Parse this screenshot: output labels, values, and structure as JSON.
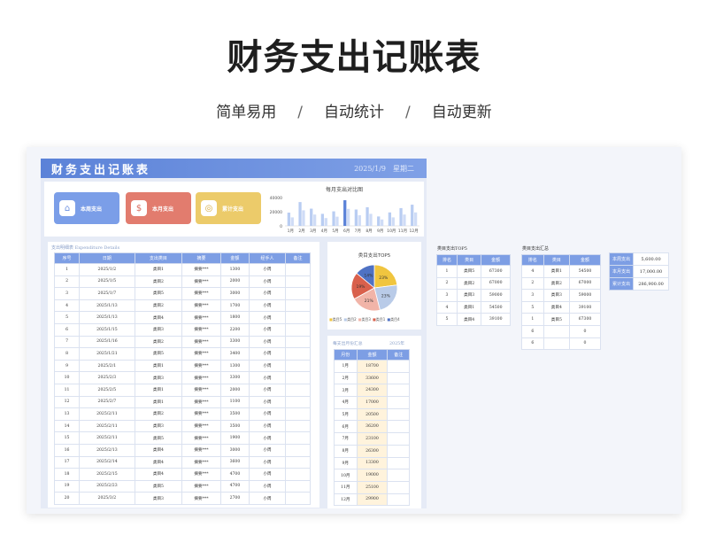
{
  "hero": {
    "title": "财务支出记账表",
    "tags": [
      "简单易用",
      "自动统计",
      "自动更新"
    ],
    "separator": "/"
  },
  "sheet": {
    "title": "财务支出记账表",
    "date": "2025/1/9",
    "weekday": "星期二"
  },
  "cards": [
    {
      "label": "本周支出",
      "color": "#7b9ee8",
      "icon": "calendar-icon",
      "glyph": "⌂"
    },
    {
      "label": "本月支出",
      "color": "#e27c6e",
      "icon": "money-bag-icon",
      "glyph": "$"
    },
    {
      "label": "累计支出",
      "color": "#eccb6a",
      "icon": "coin-icon",
      "glyph": "◎"
    }
  ],
  "chart_data": [
    {
      "type": "bar",
      "title": "每月支出对比图",
      "categories": [
        "1月",
        "2月",
        "3月",
        "4月",
        "5月",
        "6月",
        "7月",
        "8月",
        "9月",
        "10月",
        "11月",
        "12月"
      ],
      "ylim": [
        0,
        40000
      ],
      "yticks": [
        "40000",
        "20000",
        "0"
      ],
      "series": [
        {
          "values": [
            18700,
            33600,
            24300,
            17000,
            20500,
            36200,
            23100,
            26300,
            13300,
            19000,
            25100,
            29900
          ],
          "color": "#b9cdf2"
        },
        {
          "values": [
            12000,
            22000,
            16000,
            11000,
            13000,
            24000,
            15000,
            17000,
            9000,
            12000,
            16000,
            19000
          ],
          "color": "#cfdcf6"
        }
      ],
      "highlight_index": 5,
      "highlight_color": "#5b82d8"
    },
    {
      "type": "pie",
      "title": "类目支出TOP5",
      "categories": [
        "类目5",
        "类目2",
        "类目3",
        "类目1",
        "类目4"
      ],
      "values": [
        23,
        23,
        21,
        19,
        14
      ],
      "labels": [
        "23%",
        "23%",
        "21%",
        "19%",
        "14%"
      ],
      "colors": [
        "#f0c53f",
        "#b9cbe8",
        "#f1b4a8",
        "#d9604c",
        "#4f72c4"
      ]
    }
  ],
  "detail": {
    "caption": "支出明细表    Expenditure Details",
    "headers": [
      "序号",
      "日期",
      "支出类目",
      "摘要",
      "金额",
      "经手人",
      "备注"
    ],
    "rows": [
      [
        "1",
        "2025/1/2",
        "类目1",
        "摘要***",
        "1300",
        "小周",
        ""
      ],
      [
        "2",
        "2025/1/5",
        "类目2",
        "摘要***",
        "2000",
        "小周",
        ""
      ],
      [
        "3",
        "2025/1/7",
        "类目5",
        "摘要***",
        "3000",
        "小周",
        ""
      ],
      [
        "4",
        "2025/1/13",
        "类目2",
        "摘要***",
        "1700",
        "小周",
        ""
      ],
      [
        "5",
        "2025/1/13",
        "类目4",
        "摘要***",
        "1800",
        "小周",
        ""
      ],
      [
        "6",
        "2025/1/15",
        "类目3",
        "摘要***",
        "2200",
        "小周",
        ""
      ],
      [
        "7",
        "2025/1/16",
        "类目2",
        "摘要***",
        "3300",
        "小周",
        ""
      ],
      [
        "8",
        "2025/1/21",
        "类目5",
        "摘要***",
        "3400",
        "小周",
        ""
      ],
      [
        "9",
        "2025/2/1",
        "类目1",
        "摘要***",
        "1300",
        "小周",
        ""
      ],
      [
        "10",
        "2025/2/3",
        "类目3",
        "摘要***",
        "3300",
        "小周",
        ""
      ],
      [
        "11",
        "2025/2/5",
        "类目1",
        "摘要***",
        "2000",
        "小周",
        ""
      ],
      [
        "12",
        "2025/2/7",
        "类目1",
        "摘要***",
        "1100",
        "小周",
        ""
      ],
      [
        "13",
        "2025/2/11",
        "类目2",
        "摘要***",
        "3500",
        "小周",
        ""
      ],
      [
        "14",
        "2025/2/11",
        "类目3",
        "摘要***",
        "3500",
        "小周",
        ""
      ],
      [
        "15",
        "2025/2/11",
        "类目5",
        "摘要***",
        "1900",
        "小周",
        ""
      ],
      [
        "16",
        "2025/2/13",
        "类目4",
        "摘要***",
        "3000",
        "小周",
        ""
      ],
      [
        "17",
        "2025/2/14",
        "类目4",
        "摘要***",
        "3600",
        "小周",
        ""
      ],
      [
        "18",
        "2025/2/15",
        "类目4",
        "摘要***",
        "4700",
        "小周",
        ""
      ],
      [
        "19",
        "2025/2/23",
        "类目5",
        "摘要***",
        "4700",
        "小周",
        ""
      ],
      [
        "20",
        "2025/3/2",
        "类目3",
        "摘要***",
        "2700",
        "小周",
        ""
      ]
    ]
  },
  "month_summary": {
    "caption": "每支出月份汇总",
    "year": "2025年",
    "headers": [
      "月份",
      "金额",
      "备注"
    ],
    "rows": [
      [
        "1月",
        "18700",
        ""
      ],
      [
        "2月",
        "33600",
        ""
      ],
      [
        "3月",
        "24300",
        ""
      ],
      [
        "4月",
        "17000",
        ""
      ],
      [
        "5月",
        "20500",
        ""
      ],
      [
        "6月",
        "36200",
        ""
      ],
      [
        "7月",
        "23100",
        ""
      ],
      [
        "8月",
        "26300",
        ""
      ],
      [
        "9月",
        "13300",
        ""
      ],
      [
        "10月",
        "19000",
        ""
      ],
      [
        "11月",
        "25100",
        ""
      ],
      [
        "12月",
        "29900",
        ""
      ]
    ]
  },
  "top5": {
    "caption": "类目支出TOP5",
    "headers": [
      "排名",
      "类目",
      "金额"
    ],
    "rows": [
      [
        "1",
        "类目5",
        "67300"
      ],
      [
        "2",
        "类目2",
        "67000"
      ],
      [
        "3",
        "类目3",
        "59000"
      ],
      [
        "4",
        "类目1",
        "54500"
      ],
      [
        "5",
        "类目4",
        "39100"
      ]
    ]
  },
  "category_summary": {
    "caption": "类目支出汇总",
    "headers": [
      "排名",
      "类目",
      "金额"
    ],
    "rows": [
      [
        "4",
        "类目1",
        "54500"
      ],
      [
        "2",
        "类目2",
        "67000"
      ],
      [
        "3",
        "类目3",
        "59000"
      ],
      [
        "5",
        "类目4",
        "39100"
      ],
      [
        "1",
        "类目5",
        "67300"
      ],
      [
        "6",
        "",
        "0"
      ],
      [
        "6",
        "",
        "0"
      ]
    ]
  },
  "totals": [
    {
      "label": "本周支出",
      "value": "5,600.00"
    },
    {
      "label": "本月支出",
      "value": "17,000.00"
    },
    {
      "label": "累计支出",
      "value": "286,900.00"
    }
  ]
}
